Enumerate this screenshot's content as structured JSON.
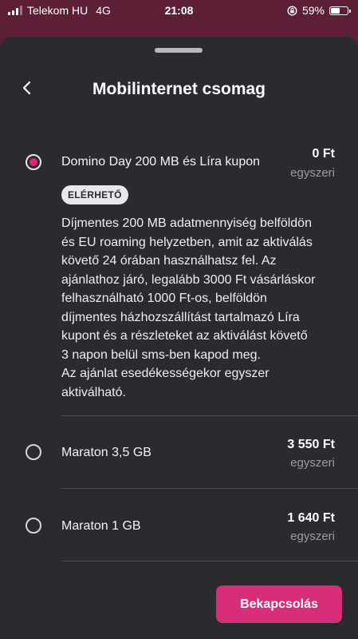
{
  "status_bar": {
    "carrier": "Telekom HU",
    "network": "4G",
    "time": "21:08",
    "battery": "59%",
    "battery_level": 0.59
  },
  "header": {
    "title": "Mobilinternet csomag",
    "back_icon": "chevron-left-icon"
  },
  "options": [
    {
      "name": "Domino Day 200 MB és Líra kupon",
      "price": "0 Ft",
      "price_note": "egyszeri",
      "selected": true,
      "badge": "ELÉRHETŐ",
      "description": "Díjmentes 200 MB adatmennyiség belföldön\nés EU roaming helyzetben, amit az aktiválás\nkövető 24 órában használhatsz fel. Az\najánlathoz járó, legalább 3000 Ft vásárláskor\nfelhasználható 1000 Ft-os, belföldön\ndíjmentes házhozszállítást tartalmazó Líra\nkupont és a részleteket az aktiválást követő\n3 napon belül sms-ben kapod meg.\nAz ajánlat esedékességekor egyszer\naktiválható."
    },
    {
      "name": "Maraton 3,5 GB",
      "price": "3 550 Ft",
      "price_note": "egyszeri",
      "selected": false
    },
    {
      "name": "Maraton 1 GB",
      "price": "1 640 Ft",
      "price_note": "egyszeri",
      "selected": false
    }
  ],
  "action": {
    "label": "Bekapcsolás"
  },
  "colors": {
    "accent": "#d82d78",
    "radio_selected": "#e2247a",
    "sheet_bg": "#2b2a2f",
    "backdrop": "#5c1f36"
  }
}
